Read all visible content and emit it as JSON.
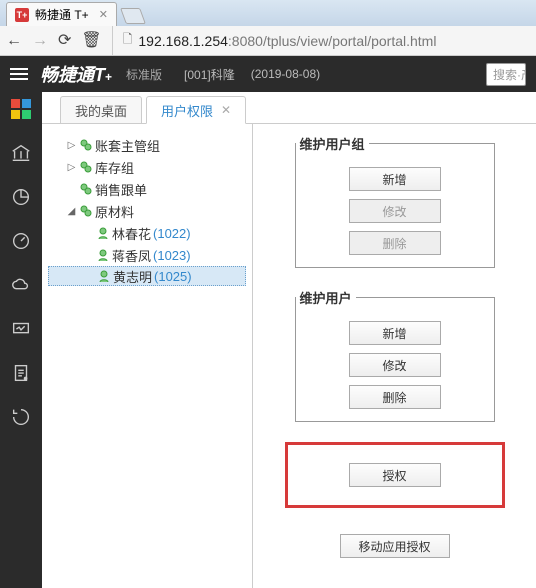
{
  "browser": {
    "tab_title": "畅捷通 T+",
    "tab_badge": "T+",
    "url_ip": "192.168.1.254",
    "url_rest": ":8080/tplus/view/portal/portal.html"
  },
  "header": {
    "brand": "畅捷通",
    "product": "T",
    "plus": "+",
    "edition": "标准版",
    "org": "[001]科隆",
    "date": "(2019-08-08)",
    "search_placeholder": "搜索·产"
  },
  "tabs": {
    "desktop": "我的桌面",
    "user_perm": "用户权限"
  },
  "tree": {
    "g1": "账套主管组",
    "g2": "库存组",
    "g3": "销售跟单",
    "g4": "原材料",
    "u1_name": "林春花",
    "u1_id": "(1022)",
    "u2_name": "蒋香凤",
    "u2_id": "(1023)",
    "u3_name": "黄志明",
    "u3_id": "(1025)"
  },
  "panel": {
    "group_legend": "维护用户组",
    "user_legend": "维护用户",
    "btn_new": "新增",
    "btn_edit": "修改",
    "btn_del": "删除",
    "btn_auth": "授权",
    "btn_mobile": "移动应用授权"
  }
}
